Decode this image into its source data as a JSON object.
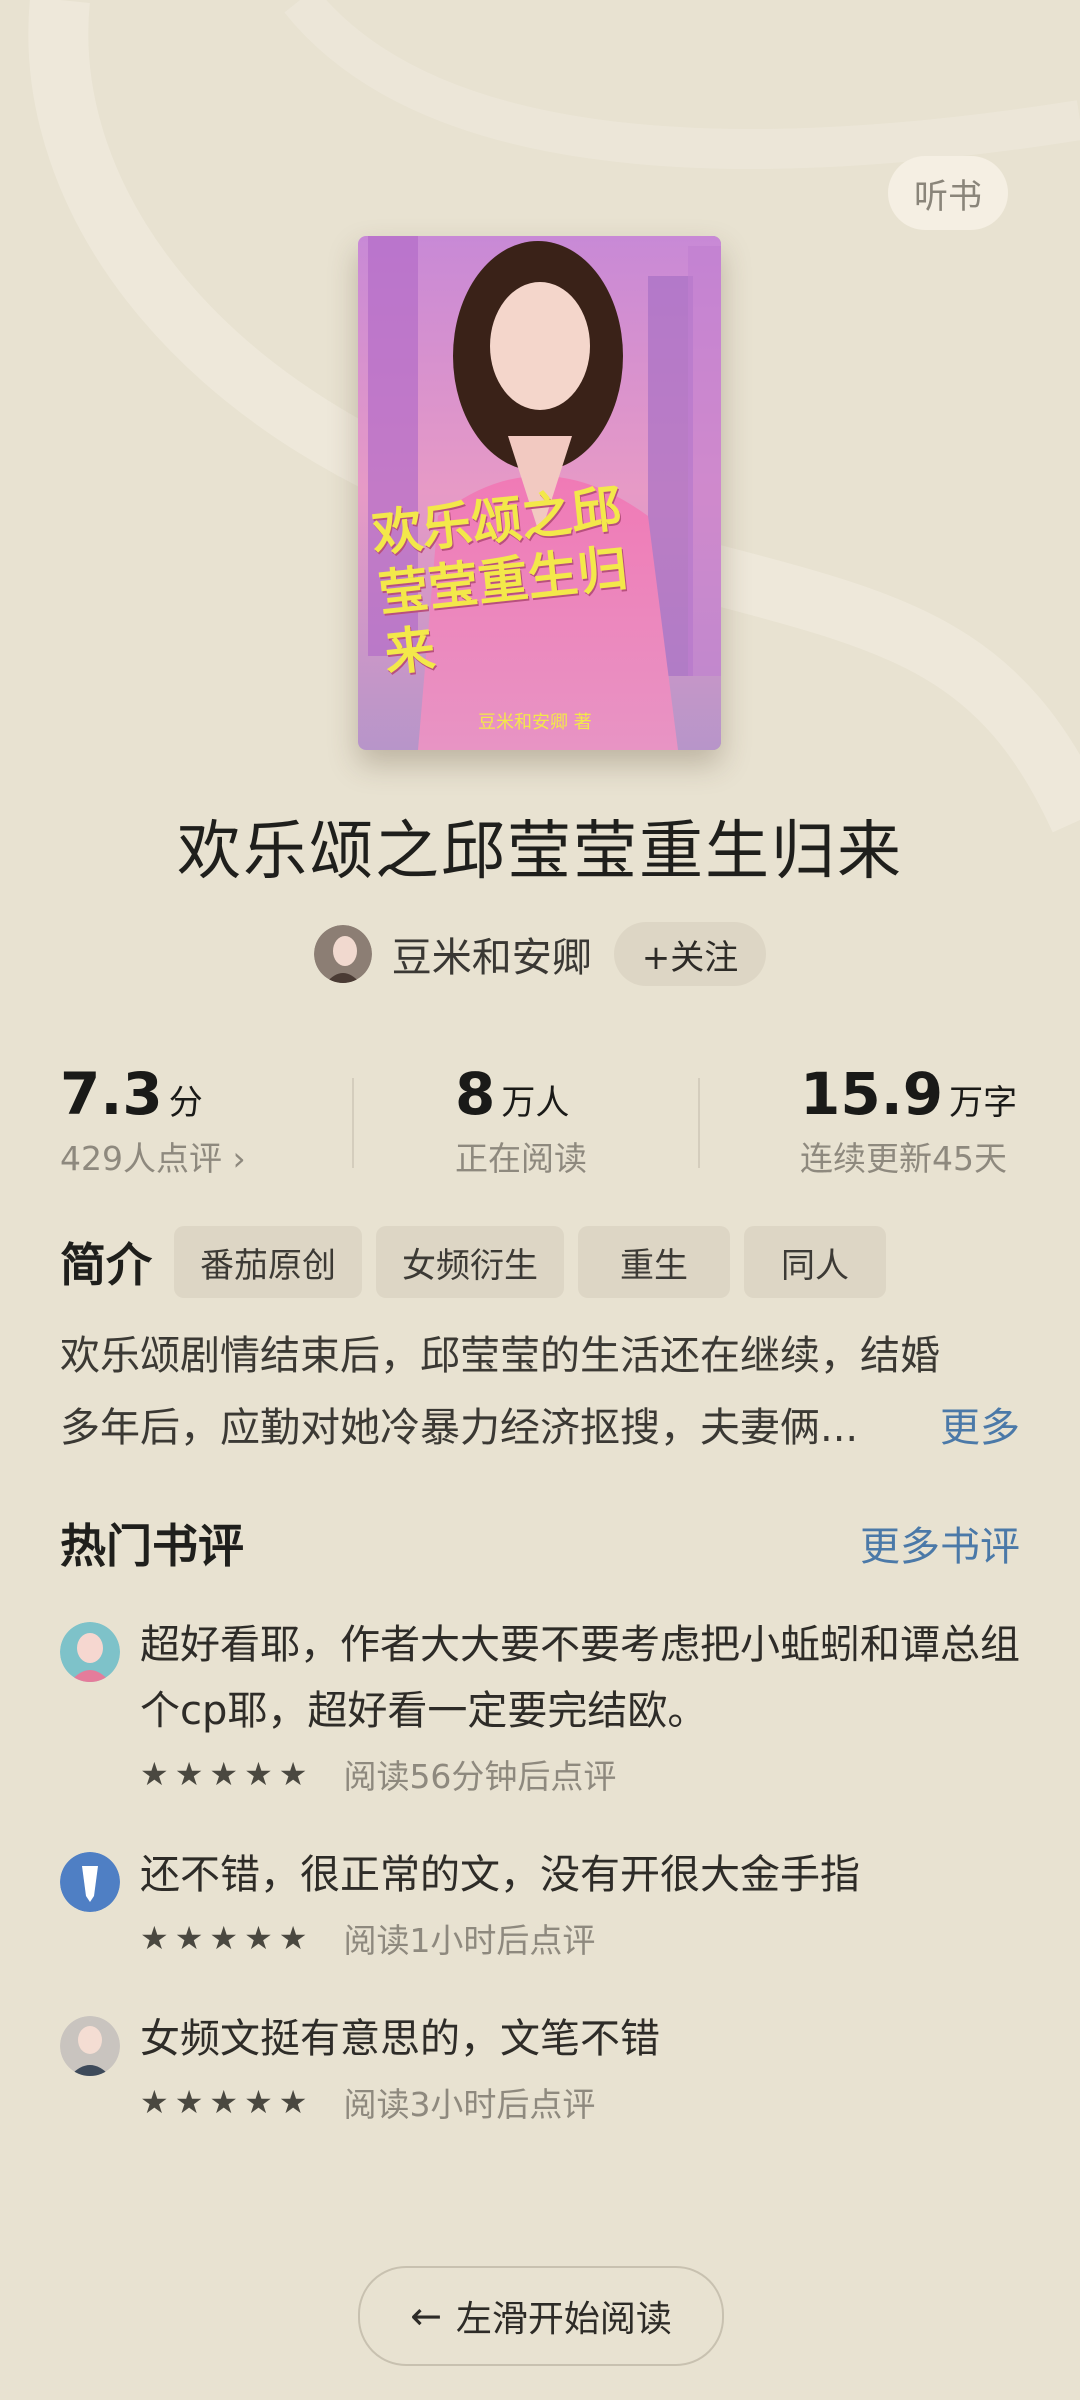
{
  "listen_label": "听书",
  "book": {
    "cover_title": "欢乐颂之邱莹莹重生归来",
    "cover_author": "豆米和安卿 著",
    "title": "欢乐颂之邱莹莹重生归来",
    "author": "豆米和安卿",
    "follow_label": "+关注"
  },
  "stats": [
    {
      "value": "7.3",
      "unit": "分",
      "sub": "429人点评 ›"
    },
    {
      "value": "8",
      "unit": "万人",
      "sub": "正在阅读"
    },
    {
      "value": "15.9",
      "unit": "万字",
      "sub": "连续更新45天"
    }
  ],
  "intro": {
    "label": "简介",
    "tags": [
      "番茄原创",
      "女频衍生",
      "重生",
      "同人"
    ],
    "line1": "欢乐颂剧情结束后，邱莹莹的生活还在继续，结婚",
    "line2": "多年后，应勤对她冷暴力经济抠搜，夫妻俩...",
    "more": "更多"
  },
  "reviews": {
    "title": "热门书评",
    "more": "更多书评",
    "items": [
      {
        "text": "超好看耶，作者大大要不要考虑把小蚯蚓和谭总组个cp耶，超好看一定要完结欧。",
        "stars": "★★★★★",
        "meta": "阅读56分钟后点评"
      },
      {
        "text": "还不错，很正常的文，没有开很大金手指",
        "stars": "★★★★★",
        "meta": "阅读1小时后点评"
      },
      {
        "text": "女频文挺有意思的，文笔不错",
        "stars": "★★★★★",
        "meta": "阅读3小时后点评"
      }
    ]
  },
  "start_label": "左滑开始阅读",
  "colors": {
    "background": "#e8e2d1",
    "link": "#4b79a8",
    "cover_pink": "#e06fa8"
  }
}
